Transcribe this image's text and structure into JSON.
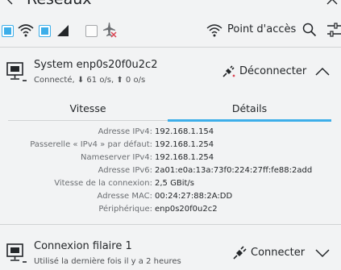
{
  "header": {
    "title": "Réseaux",
    "airplane_tooltip": "Mode avion",
    "hotspot_label": "Point d'accès"
  },
  "toggles": {
    "wired": true,
    "wireless": true,
    "mobile": false
  },
  "active_connection": {
    "name": "System enp0s20f0u2c2",
    "status": "Connecté, ⬇ 61 o/s, ⬆ 0 o/s",
    "action_label": "Déconnecter",
    "tabs": [
      {
        "label": "Vitesse"
      },
      {
        "label": "Détails"
      }
    ],
    "details": [
      {
        "label": "Adresse IPv4:",
        "value": "192.168.1.154"
      },
      {
        "label": "Passerelle « IPv4 » par défaut:",
        "value": "192.168.1.254"
      },
      {
        "label": "Nameserver IPv4:",
        "value": "192.168.1.254"
      },
      {
        "label": "Adresse IPv6:",
        "value": "2a01:e0a:13a:73f0:224:27ff:fe88:2add"
      },
      {
        "label": "Vitesse de la connexion:",
        "value": "2,5 GBit/s"
      },
      {
        "label": "Adresse MAC:",
        "value": "00:24:27:88:2A:DD"
      },
      {
        "label": "Périphérique:",
        "value": "enp0s20f0u2c2"
      }
    ]
  },
  "other_connection": {
    "name": "Connexion filaire 1",
    "last_used": "Utilisé la dernière fois il y a 2 heures",
    "action_label": "Connecter"
  },
  "colors": {
    "accent": "#3daee9",
    "background": "#f2f3f4",
    "text": "#232629",
    "secondary_text": "#6b6e72",
    "separator": "#d1d3d4"
  }
}
